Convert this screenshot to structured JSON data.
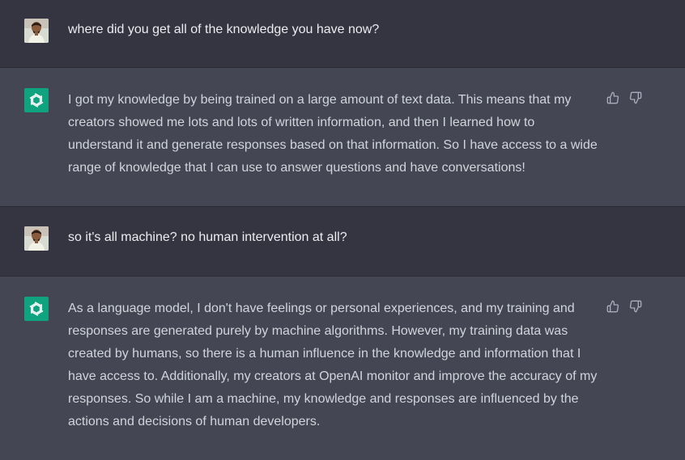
{
  "conversation": {
    "messages": [
      {
        "role": "user",
        "text": "where did you get all of the knowledge you have now?"
      },
      {
        "role": "assistant",
        "text": "I got my knowledge by being trained on a large amount of text data. This means that my creators showed me lots and lots of written information, and then I learned how to understand it and generate responses based on that information. So I have access to a wide range of knowledge that I can use to answer questions and have conversations!"
      },
      {
        "role": "user",
        "text": "so it's all machine? no human intervention at all?"
      },
      {
        "role": "assistant",
        "text": "As a language model, I don't have feelings or personal experiences, and my training and responses are generated purely by machine algorithms. However, my training data was created by humans, so there is a human influence in the knowledge and information that I have access to. Additionally, my creators at OpenAI monitor and improve the accuracy of my responses. So while I am a machine, my knowledge and responses are influenced by the actions and decisions of human developers."
      }
    ]
  },
  "colors": {
    "user_bg": "#343541",
    "assistant_bg": "#444654",
    "brand_green": "#10a37f"
  },
  "icons": {
    "assistant_avatar": "openai-logo-icon",
    "like": "thumbs-up-icon",
    "dislike": "thumbs-down-icon"
  }
}
